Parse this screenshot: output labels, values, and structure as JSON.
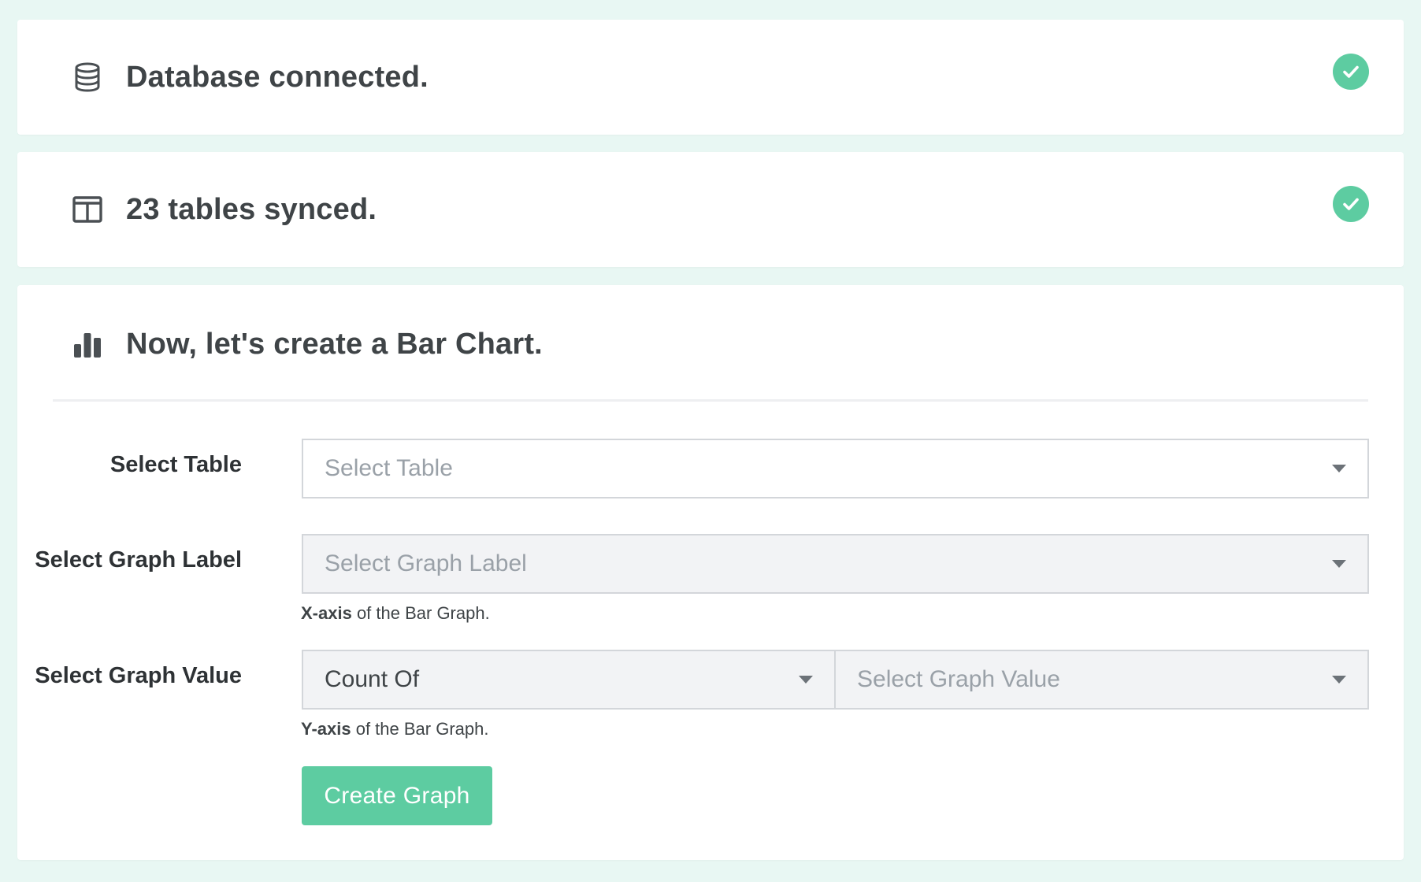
{
  "status": {
    "database": {
      "text": "Database connected.",
      "icon": "database-icon",
      "done": true
    },
    "tables": {
      "text": "23 tables synced.",
      "icon": "table-icon",
      "done": true
    }
  },
  "chart_builder": {
    "title": "Now, let's create a Bar Chart.",
    "icon": "bar-chart-icon",
    "select_table": {
      "label": "Select Table",
      "placeholder": "Select Table"
    },
    "graph_label": {
      "label": "Select Graph Label",
      "placeholder": "Select Graph Label",
      "help_bold": "X-axis",
      "help_text": " of the Bar Graph."
    },
    "graph_value": {
      "label": "Select Graph Value",
      "aggregate_value": "Count Of",
      "placeholder": "Select Graph Value",
      "help_bold": "Y-axis",
      "help_text": " of the Bar Graph."
    },
    "submit_label": "Create Graph"
  },
  "colors": {
    "page_bg": "#e8f7f3",
    "accent": "#5dcca1",
    "text": "#3f4447"
  }
}
